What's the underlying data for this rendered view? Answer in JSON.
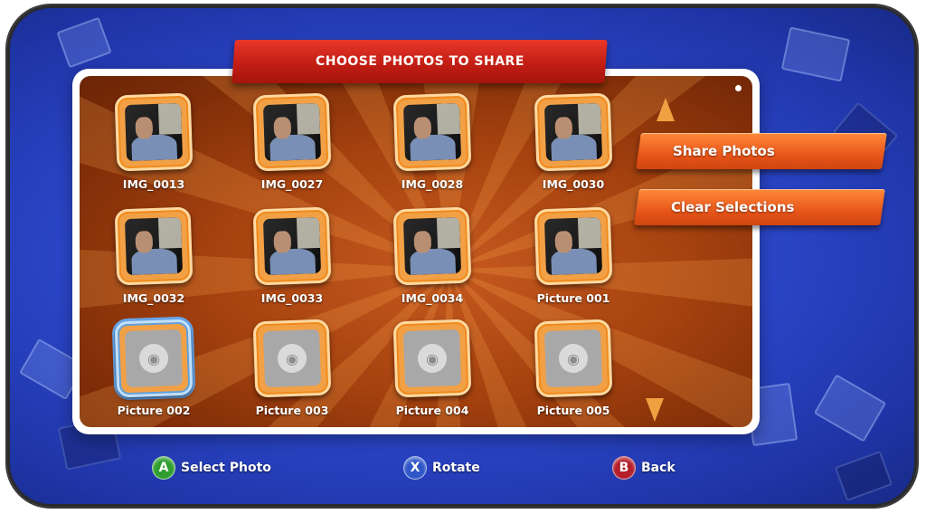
{
  "header": {
    "title": "CHOOSE PHOTOS TO SHARE"
  },
  "photos": [
    {
      "label": "IMG_0013",
      "kind": "photo",
      "selected": false
    },
    {
      "label": "IMG_0027",
      "kind": "photo",
      "selected": false
    },
    {
      "label": "IMG_0028",
      "kind": "photo",
      "selected": false
    },
    {
      "label": "IMG_0030",
      "kind": "photo",
      "selected": false
    },
    {
      "label": "IMG_0032",
      "kind": "photo",
      "selected": false
    },
    {
      "label": "IMG_0033",
      "kind": "photo",
      "selected": false
    },
    {
      "label": "IMG_0034",
      "kind": "photo",
      "selected": false
    },
    {
      "label": "Picture 001",
      "kind": "photo",
      "selected": false
    },
    {
      "label": "Picture 002",
      "kind": "placeholder",
      "selected": true
    },
    {
      "label": "Picture 003",
      "kind": "placeholder",
      "selected": false
    },
    {
      "label": "Picture 004",
      "kind": "placeholder",
      "selected": false
    },
    {
      "label": "Picture 005",
      "kind": "placeholder",
      "selected": false
    }
  ],
  "actions": {
    "share_photos": "Share Photos",
    "clear_selections": "Clear Selections"
  },
  "scroll": {
    "up_icon": "up-arrow-icon",
    "down_icon": "down-arrow-icon"
  },
  "controller_hints": [
    {
      "button": "A",
      "label": "Select Photo",
      "color": "#2f9e2f"
    },
    {
      "button": "X",
      "label": "Rotate",
      "color": "#2f57c8"
    },
    {
      "button": "B",
      "label": "Back",
      "color": "#b51f2a"
    }
  ],
  "colors": {
    "panel_orange": "#a6420f",
    "banner_red": "#bf1c12",
    "button_orange": "#e8561a",
    "background_blue": "#2c48cc"
  }
}
